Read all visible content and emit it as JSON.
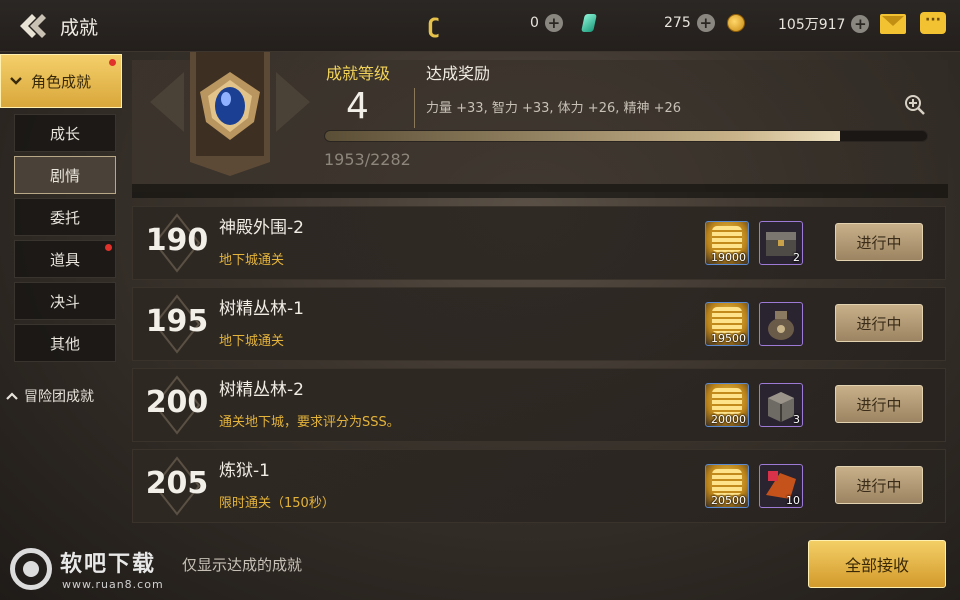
{
  "header": {
    "title": "成就",
    "currencies": [
      {
        "name": "hook-currency",
        "value": "0"
      },
      {
        "name": "gem-currency",
        "value": "275"
      },
      {
        "name": "gold-currency",
        "value": "105万917"
      }
    ]
  },
  "sidebar": {
    "main_label": "角色成就",
    "items": [
      {
        "label": "成长"
      },
      {
        "label": "剧情"
      },
      {
        "label": "委托"
      },
      {
        "label": "道具"
      },
      {
        "label": "决斗"
      },
      {
        "label": "其他"
      }
    ],
    "active_item": "剧情",
    "team_label": "冒险团成就"
  },
  "summary": {
    "level_label": "成就等级",
    "level_value": "4",
    "reward_label": "达成奖励",
    "reward_text": "力量 +33, 智力 +33, 体力 +26, 精神 +26",
    "progress_text": "1953/2282",
    "progress_fraction": 0.856
  },
  "achievements": [
    {
      "points": "190",
      "title": "神殿外围-2",
      "desc": "地下城通关",
      "gold": "19000",
      "item_count": "2",
      "item_icon": "chest-icon",
      "status": "进行中"
    },
    {
      "points": "195",
      "title": "树精丛林-1",
      "desc": "地下城通关",
      "gold": "19500",
      "item_count": "",
      "item_icon": "pouch-icon",
      "status": "进行中"
    },
    {
      "points": "200",
      "title": "树精丛林-2",
      "desc": "通关地下城，要求评分为SSS。",
      "gold": "20000",
      "item_count": "3",
      "item_icon": "box-icon",
      "status": "进行中"
    },
    {
      "points": "205",
      "title": "炼狱-1",
      "desc": "限时通关（150秒）",
      "gold": "20500",
      "item_count": "10",
      "item_icon": "crystal-icon",
      "status": "进行中"
    }
  ],
  "footer": {
    "watermark_name": "软吧下载",
    "watermark_url": "www.ruan8.com",
    "filter_label": "仅显示达成的成就",
    "receive_all": "全部接收"
  },
  "colors": {
    "accent_gold": "#f0d25a",
    "desc_orange": "#e3b33a",
    "button_gold": "#d39a2c"
  }
}
